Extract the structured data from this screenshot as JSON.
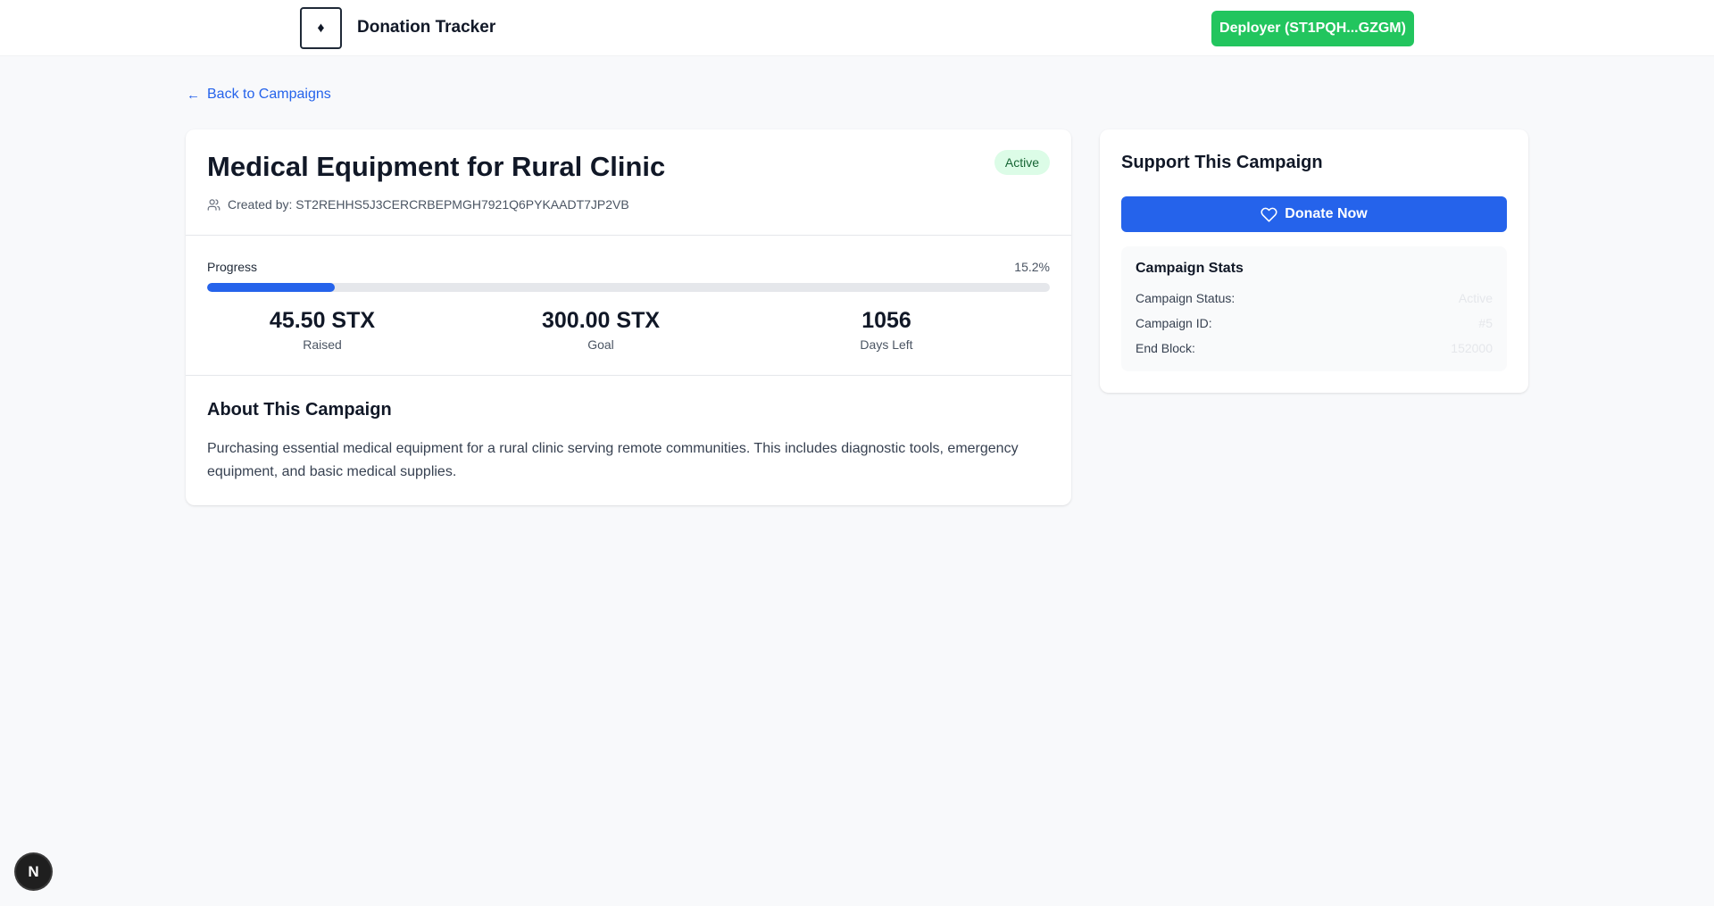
{
  "header": {
    "logo_glyph": "♦",
    "app_title": "Donation Tracker",
    "deployer_label": "Deployer (ST1PQH...GZGM)"
  },
  "nav": {
    "back_label": "Back to Campaigns"
  },
  "campaign": {
    "title": "Medical Equipment for Rural Clinic",
    "status": "Active",
    "created_by": "Created by: ST2REHHS5J3CERCRBEPMGH7921Q6PYKAADT7JP2VB",
    "progress_label": "Progress",
    "progress_percent_text": "15.2%",
    "progress_fraction": 0.152,
    "stats": [
      {
        "value": "45.50 STX",
        "label": "Raised"
      },
      {
        "value": "300.00 STX",
        "label": "Goal"
      },
      {
        "value": "1056",
        "label": "Days Left"
      }
    ],
    "about_title": "About This Campaign",
    "about_text": "Purchasing essential medical equipment for a rural clinic serving remote communities. This includes diagnostic tools, emergency equipment, and basic medical supplies."
  },
  "support": {
    "title": "Support This Campaign",
    "donate_label": "Donate Now",
    "stats_title": "Campaign Stats",
    "rows": [
      {
        "key": "Campaign Status:",
        "value": "Active"
      },
      {
        "key": "Campaign ID:",
        "value": "#5"
      },
      {
        "key": "End Block:",
        "value": "152000"
      }
    ]
  },
  "devtools": {
    "badge_label": "N"
  },
  "colors": {
    "accent_blue": "#2563eb",
    "deployer_green": "#22c55e",
    "active_badge_bg": "#dcfce7",
    "active_badge_text": "#166534"
  }
}
